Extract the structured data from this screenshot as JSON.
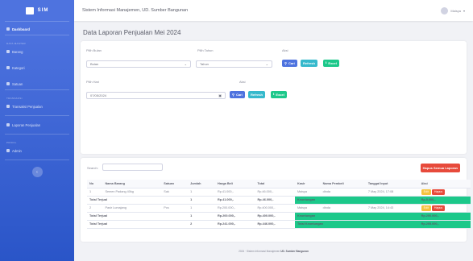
{
  "brand": {
    "name": "SIM"
  },
  "sidebar": {
    "dashboard": "Dashboard",
    "heading_master": "DATA MASTER",
    "barang": "Barang",
    "kategori": "Kategori",
    "satuan": "Satuan",
    "heading_transaksi": "TRANSAKSI",
    "transaksi_penjualan": "Transaksi Penjualan",
    "laporan_penjualan": "Laporan Penjualan",
    "heading_profil": "PROFIL",
    "admin": "Admin"
  },
  "topbar": {
    "title": "Sistem Informasi Manajemen, UD. Sumber Bangunan",
    "user": "Maisya"
  },
  "page": {
    "title": "Data Laporan Penjualan Mei 2024"
  },
  "filter": {
    "bulan_label": "Pilih Bulan",
    "bulan_value": "Bulan",
    "tahun_label": "Pilih Tahun",
    "tahun_value": "Tahun",
    "aksi_label": "Aksi",
    "hari_label": "Pilih Hari",
    "hari_value": "07/05/2024",
    "aksi2_label": "Aksi",
    "cari": "Cari",
    "refresh": "Refresh",
    "excel": "Excel"
  },
  "table": {
    "search_label": "Search:",
    "hapus_semua": "Hapus Semua Laporan",
    "headers": [
      "No",
      "Nama Barang",
      "Satuan",
      "Jumlah",
      "Harga Beli",
      "Total",
      "Kasir",
      "Nama Pembeli",
      "Tanggal Input",
      "Aksi"
    ],
    "rows": [
      {
        "no": "1",
        "nama": "Semen Padang 40kg",
        "satuan": "Sak",
        "jumlah": "1",
        "harga": "Rp.41.000,-",
        "total": "Rp.46.000,-",
        "kasir": "Maisya",
        "pembeli": "dinda",
        "tanggal": "7 May 2024, 17:08"
      },
      {
        "no": "2",
        "nama": "Pasir Lumajang",
        "satuan": "Pcs",
        "jumlah": "1",
        "harga": "Rp.200.000,-",
        "total": "Rp.400.000,-",
        "kasir": "Maisya",
        "pembeli": "dinda",
        "tanggal": "7 May 2024, 14:43"
      }
    ],
    "subtotals": [
      {
        "label": "Total Terjual",
        "jumlah": "1",
        "harga": "Rp.41.000,-",
        "total": "Rp.46.000,-",
        "keuntungan_label": "Keuntungan",
        "keuntungan": "Rp.5.000,-"
      },
      {
        "label": "Total Terjual",
        "jumlah": "1",
        "harga": "Rp.200.000,-",
        "total": "Rp.400.000,-",
        "keuntungan_label": "Keuntungan",
        "keuntungan": "Rp.200.000,-"
      }
    ],
    "grand": {
      "label": "Total Terjual",
      "jumlah": "2",
      "harga": "Rp.241.000,-",
      "total": "Rp.446.000,-",
      "keuntungan_label": "Total Keuntungan",
      "keuntungan": "Rp.205.000,-"
    },
    "edit": "Edit",
    "hapus": "Hapus"
  },
  "footer": {
    "text": "2024 · Sistem Informasi Manajemen",
    "brand": "UD. Sumber Bangunan"
  },
  "colors": {
    "primary": "#4e73df",
    "success": "#1cc88a",
    "info": "#36b9cc",
    "danger": "#e74a3b",
    "warning": "#f6c23e"
  }
}
